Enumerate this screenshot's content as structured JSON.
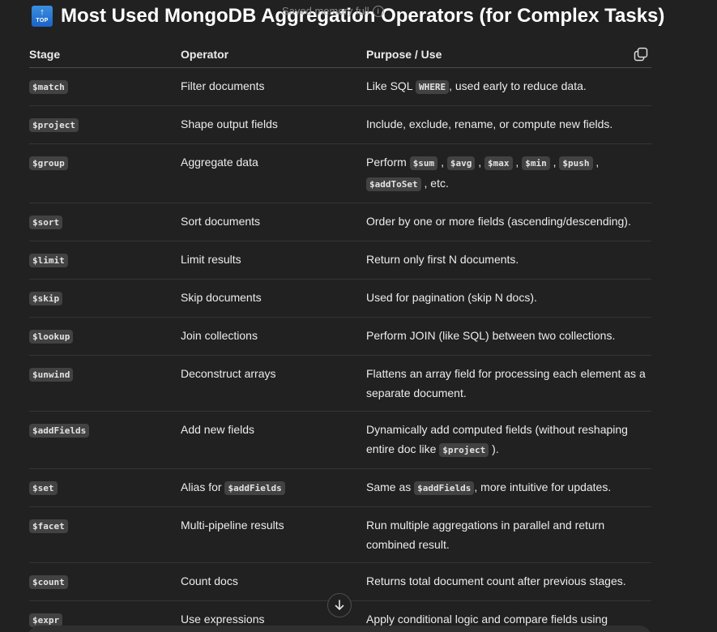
{
  "heading": {
    "icon_label": "TOP",
    "title": "Most Used MongoDB Aggregation Operators (for Complex Tasks)"
  },
  "toast": {
    "text": "Saved memory full"
  },
  "table": {
    "headers": [
      "Stage",
      "Operator",
      "Purpose / Use"
    ],
    "rows": [
      {
        "stage": "$match",
        "operator": [
          {
            "t": "Filter documents"
          }
        ],
        "purpose": [
          {
            "t": "Like SQL "
          },
          {
            "code": "WHERE"
          },
          {
            "t": ", used early to reduce data."
          }
        ]
      },
      {
        "stage": "$project",
        "operator": [
          {
            "t": "Shape output fields"
          }
        ],
        "purpose": [
          {
            "t": "Include, exclude, rename, or compute new fields."
          }
        ]
      },
      {
        "stage": "$group",
        "operator": [
          {
            "t": "Aggregate data"
          }
        ],
        "purpose": [
          {
            "t": "Perform "
          },
          {
            "code": "$sum"
          },
          {
            "t": " , "
          },
          {
            "code": "$avg"
          },
          {
            "t": " , "
          },
          {
            "code": "$max"
          },
          {
            "t": " , "
          },
          {
            "code": "$min"
          },
          {
            "t": " , "
          },
          {
            "code": "$push"
          },
          {
            "t": " , "
          },
          {
            "code": "$addToSet"
          },
          {
            "t": " , etc."
          }
        ]
      },
      {
        "stage": "$sort",
        "operator": [
          {
            "t": "Sort documents"
          }
        ],
        "purpose": [
          {
            "t": "Order by one or more fields (ascending/descending)."
          }
        ]
      },
      {
        "stage": "$limit",
        "operator": [
          {
            "t": "Limit results"
          }
        ],
        "purpose": [
          {
            "t": "Return only first N documents."
          }
        ]
      },
      {
        "stage": "$skip",
        "operator": [
          {
            "t": "Skip documents"
          }
        ],
        "purpose": [
          {
            "t": "Used for pagination (skip N docs)."
          }
        ]
      },
      {
        "stage": "$lookup",
        "operator": [
          {
            "t": "Join collections"
          }
        ],
        "purpose": [
          {
            "t": "Perform JOIN (like SQL) between two collections."
          }
        ]
      },
      {
        "stage": "$unwind",
        "operator": [
          {
            "t": "Deconstruct arrays"
          }
        ],
        "purpose": [
          {
            "t": "Flattens an array field for processing each element as a separate document."
          }
        ]
      },
      {
        "stage": "$addFields",
        "operator": [
          {
            "t": "Add new fields"
          }
        ],
        "purpose": [
          {
            "t": "Dynamically add computed fields (without reshaping entire doc like "
          },
          {
            "code": "$project"
          },
          {
            "t": " )."
          }
        ]
      },
      {
        "stage": "$set",
        "operator": [
          {
            "t": "Alias for "
          },
          {
            "code": "$addFields"
          }
        ],
        "purpose": [
          {
            "t": "Same as "
          },
          {
            "code": "$addFields"
          },
          {
            "t": ", more intuitive for updates."
          }
        ]
      },
      {
        "stage": "$facet",
        "operator": [
          {
            "t": "Multi-pipeline results"
          }
        ],
        "purpose": [
          {
            "t": "Run multiple aggregations in parallel and return combined result."
          }
        ]
      },
      {
        "stage": "$count",
        "operator": [
          {
            "t": "Count docs"
          }
        ],
        "purpose": [
          {
            "t": "Returns total document count after previous stages."
          }
        ]
      },
      {
        "stage": "$expr",
        "operator": [
          {
            "t": "Use expressions"
          }
        ],
        "purpose": [
          {
            "t": "Apply conditional logic and compare fields using aggregation expressions."
          }
        ]
      }
    ]
  },
  "icons": {
    "copy": "copy-icon",
    "scroll_down": "arrow-down-icon",
    "top": "top-emoji-icon",
    "info": "info-icon"
  },
  "colors": {
    "background": "#212121",
    "text": "#ececec",
    "code_bg": "#424242",
    "row_divider": "#353535"
  }
}
